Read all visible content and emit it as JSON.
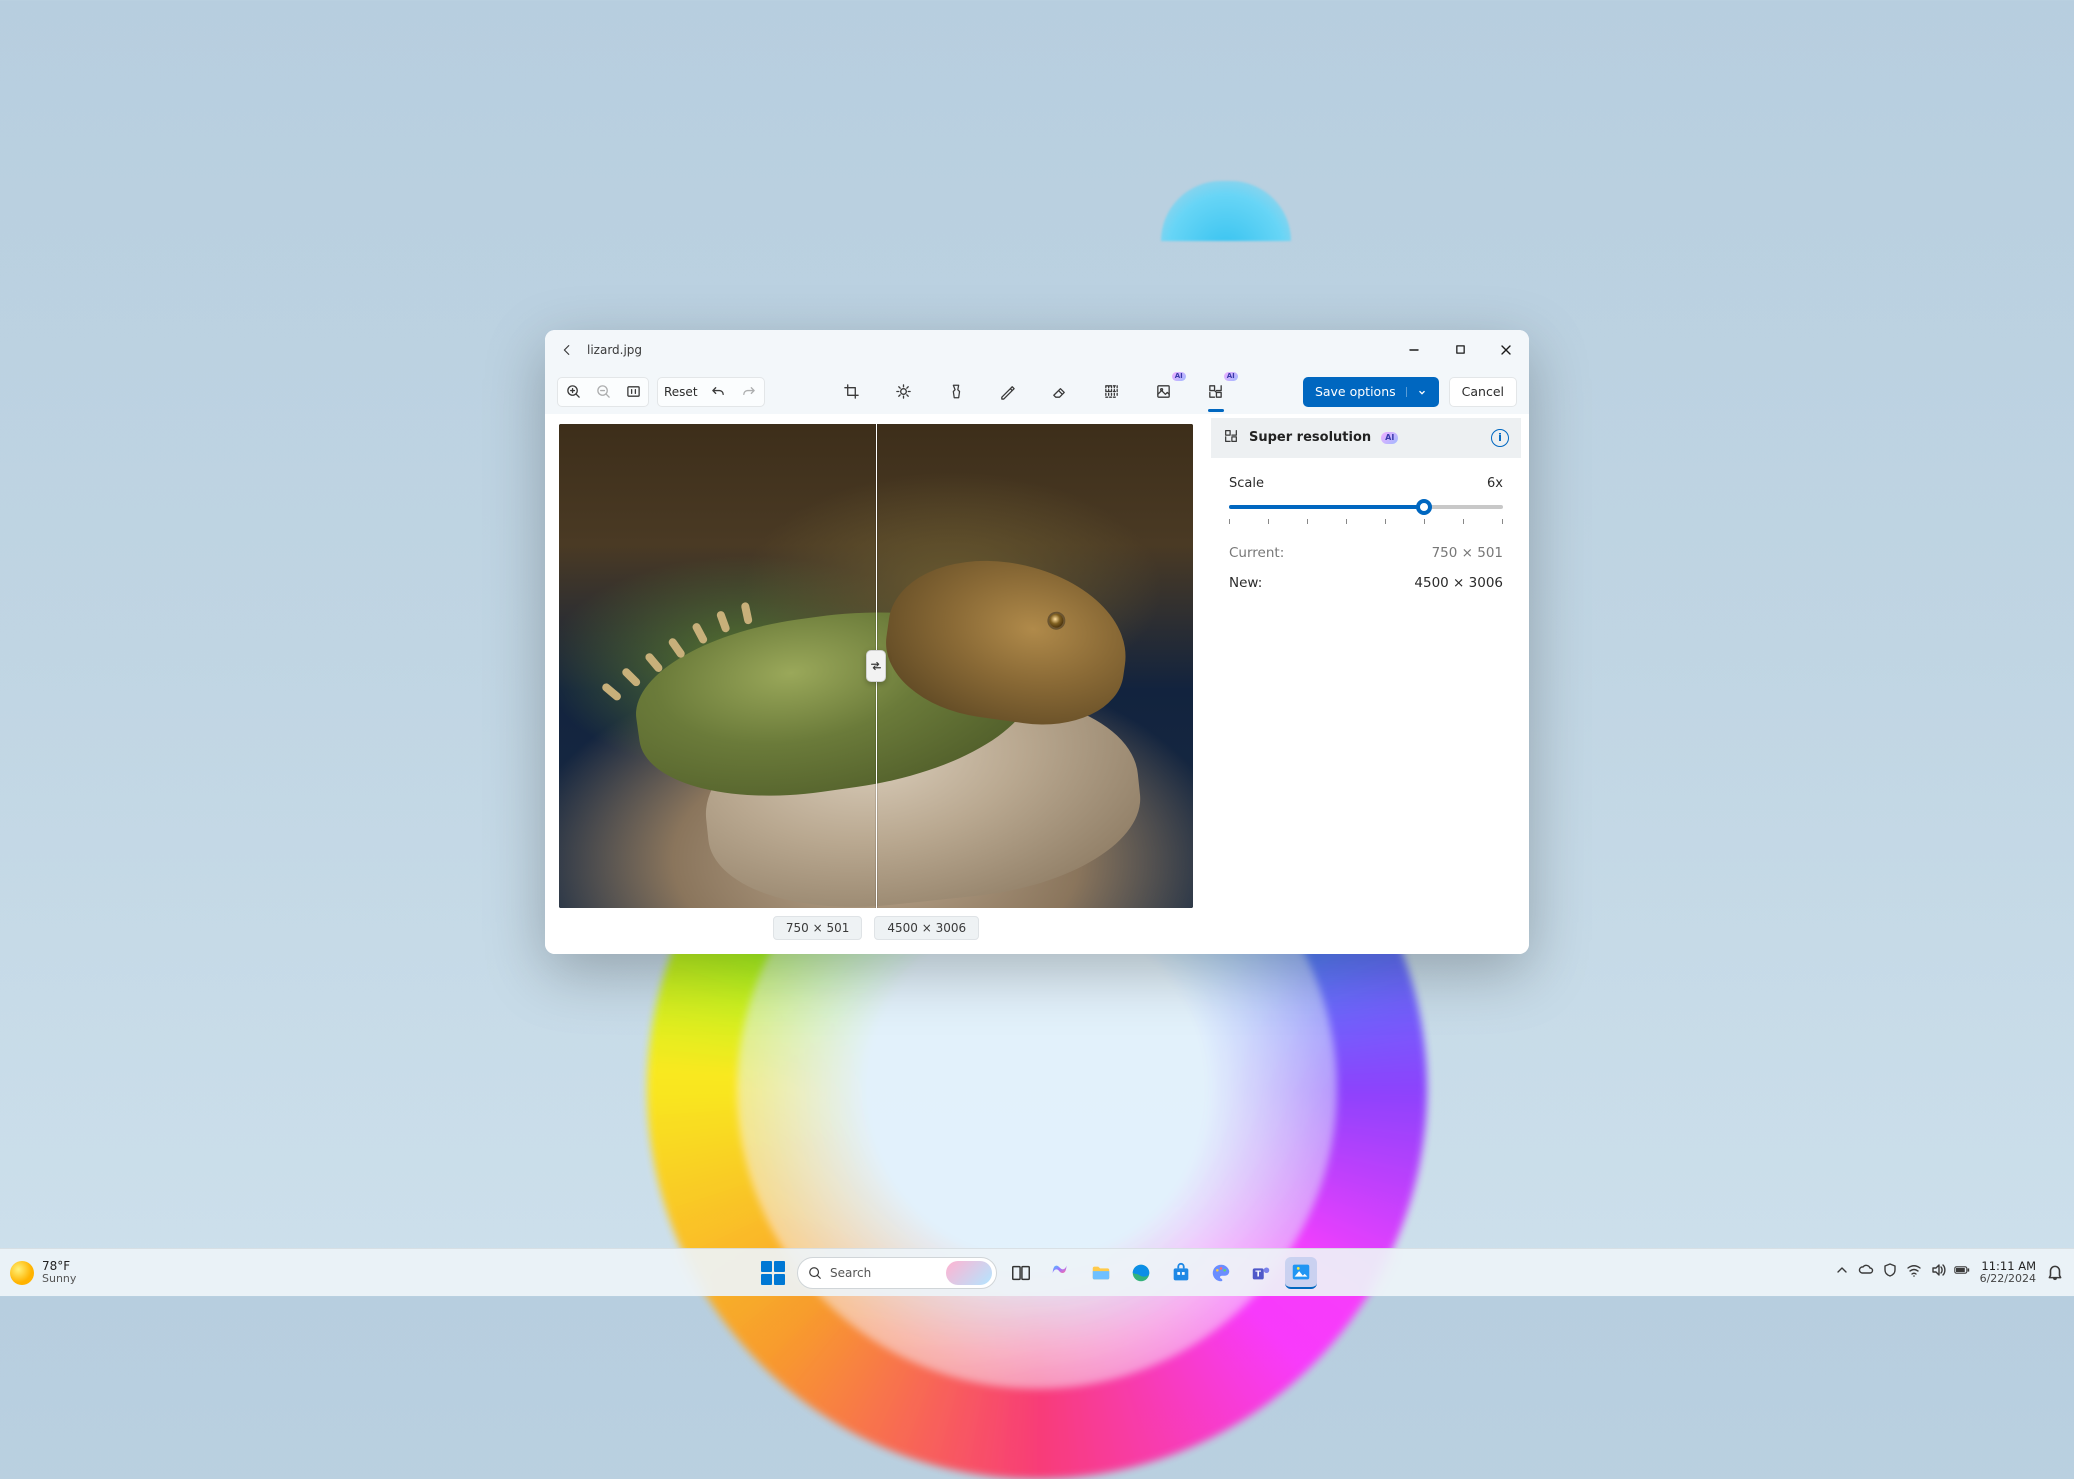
{
  "window": {
    "filename": "lizard.jpg"
  },
  "toolbar": {
    "reset": "Reset",
    "save": "Save options",
    "cancel": "Cancel",
    "ai_label": "AI"
  },
  "preview": {
    "left_dims": "750 × 501",
    "right_dims": "4500 × 3006"
  },
  "panel": {
    "title": "Super resolution",
    "ai_label": "AI",
    "scale_label": "Scale",
    "scale_value": "6x",
    "slider_percent": 71,
    "current_label": "Current:",
    "current_value": "750 × 501",
    "new_label": "New:",
    "new_value": "4500 × 3006"
  },
  "taskbar": {
    "weather_temp": "78°F",
    "weather_cond": "Sunny",
    "search_placeholder": "Search",
    "time": "11:11 AM",
    "date": "6/22/2024"
  }
}
